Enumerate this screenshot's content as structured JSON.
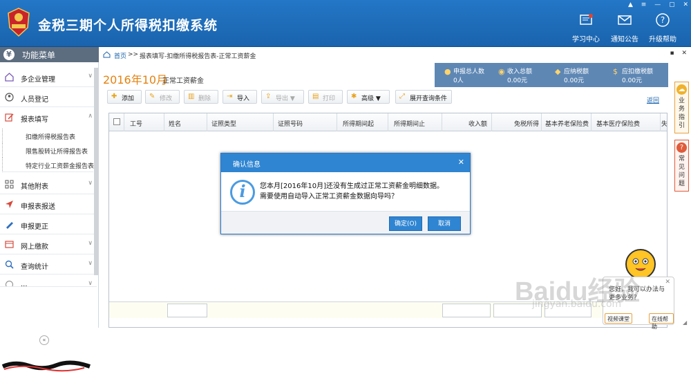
{
  "app": {
    "title": "金税三期个人所得税扣缴系统"
  },
  "header": {
    "buttons": [
      {
        "label": "学习中心",
        "icon": "book-icon"
      },
      {
        "label": "通知公告",
        "icon": "mail-icon"
      },
      {
        "label": "升级帮助",
        "icon": "help-icon"
      }
    ],
    "window_controls": [
      "▲",
      "≡",
      "—",
      "▢",
      "✕"
    ]
  },
  "sidebar": {
    "title": "功能菜单",
    "title_icon": "¥",
    "items": [
      {
        "label": "多企业管理",
        "icon": "home-icon",
        "chev": "∨"
      },
      {
        "label": "人员登记",
        "icon": "person-icon",
        "chev": ""
      },
      {
        "label": "报表填写",
        "icon": "edit-icon",
        "chev": "∧"
      },
      {
        "label": "其他附表",
        "icon": "grid-icon",
        "chev": "∨"
      },
      {
        "label": "申报表报送",
        "icon": "send-icon",
        "chev": ""
      },
      {
        "label": "申报更正",
        "icon": "pen-icon",
        "chev": ""
      },
      {
        "label": "网上缴款",
        "icon": "payment-icon",
        "chev": "∨"
      },
      {
        "label": "查询统计",
        "icon": "search-icon",
        "chev": "∨"
      },
      {
        "label": "...",
        "icon": "more-icon",
        "chev": "∨"
      }
    ],
    "subitems": [
      {
        "label": "扣缴所得税报告表"
      },
      {
        "label": "限售股转让所得报告表"
      },
      {
        "label": "特定行业工资薪金报告表"
      }
    ],
    "collapse": "«"
  },
  "breadcrumb": {
    "home": "首页",
    "sep": " >> ",
    "path": "报表填写-扣缴所得税报告表-正常工资薪金"
  },
  "page_controls": {
    "pin": "▪",
    "close": "✕"
  },
  "page": {
    "title": "2016年10月",
    "subtitle": "正常工资薪金",
    "back": "返回"
  },
  "stats": [
    {
      "label": "申报总人数",
      "value": "0人",
      "icon": "people-icon"
    },
    {
      "label": "收入总额",
      "value": "0.00元",
      "icon": "coin-icon"
    },
    {
      "label": "应纳税额",
      "value": "0.00元",
      "icon": "bag-icon"
    },
    {
      "label": "应扣缴税额",
      "value": "0.00元",
      "icon": "moneybag-icon"
    }
  ],
  "toolbar": [
    {
      "label": "添加",
      "icon": "add-icon",
      "enabled": true
    },
    {
      "label": "修改",
      "icon": "modify-icon",
      "enabled": false
    },
    {
      "label": "删除",
      "icon": "delete-icon",
      "enabled": false
    },
    {
      "label": "导入",
      "icon": "import-icon",
      "enabled": true
    },
    {
      "label": "导出 ▼",
      "icon": "export-icon",
      "enabled": false
    },
    {
      "label": "打印",
      "icon": "print-icon",
      "enabled": false
    },
    {
      "label": "高级 ▼",
      "icon": "settings-icon",
      "enabled": true
    },
    {
      "label": "展开查询条件",
      "icon": "expand-icon",
      "enabled": true
    }
  ],
  "grid": {
    "columns": [
      "工号",
      "姓名",
      "证照类型",
      "证照号码",
      "所得期间起",
      "所得期间止",
      "收入额",
      "免税所得",
      "基本养老保险费",
      "基本医疗保险费",
      "失"
    ]
  },
  "dialog": {
    "title": "确认信息",
    "close": "✕",
    "message_line1": "您本月[2016年10月]还没有生成过正常工资薪金明细数据。",
    "message_line2": "需要使用自动导入正常工资薪金数据向导吗？",
    "ok": "确定(O)",
    "cancel": "取消"
  },
  "right_tabs": [
    {
      "label": "业务指引",
      "icon": "guide-icon"
    },
    {
      "label": "常见问题",
      "icon": "question-icon"
    }
  ],
  "assistant": {
    "line1": "您好，我可以办法与",
    "line2": "更多业务？",
    "btn1": "视频课堂",
    "btn2": "在线帮助",
    "close": "✕"
  },
  "watermark": {
    "text": "Baidu经验",
    "url": "jingyan.baidu.com"
  },
  "colors": {
    "header": "#1a63ad",
    "accent": "#e38210",
    "stats_bg": "#5e87b4",
    "dialog": "#2f85d2"
  }
}
